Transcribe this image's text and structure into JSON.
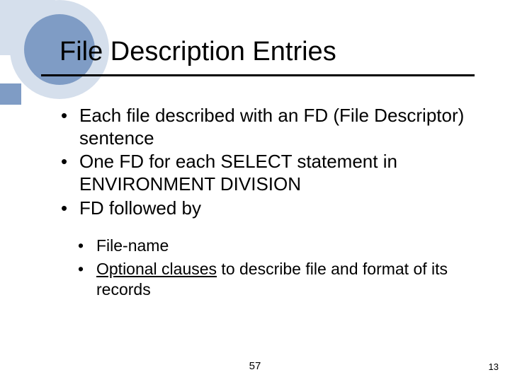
{
  "title": "File Description Entries",
  "bullets": {
    "b1": "Each file described with an FD (File Descriptor) sentence",
    "b2": "One FD for each SELECT statement in ENVIRONMENT DIVISION",
    "b3": "FD followed by",
    "sub1": "File-name",
    "sub2_underlined": "Optional clauses",
    "sub2_rest": " to describe file and format of its records"
  },
  "footer": {
    "center": "57",
    "right": "13"
  }
}
